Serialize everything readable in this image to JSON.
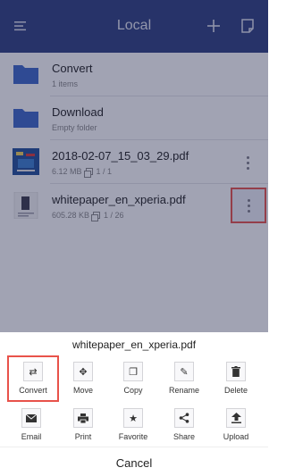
{
  "header": {
    "title": "Local",
    "left_icon": "menu-icon",
    "add_icon": "plus-icon",
    "edit_icon": "note-icon"
  },
  "files": [
    {
      "name": "Convert",
      "meta": "1 items",
      "type": "folder"
    },
    {
      "name": "Download",
      "meta": "Empty folder",
      "type": "folder"
    },
    {
      "name": "2018-02-07_15_03_29.pdf",
      "size": "6.12 MB",
      "pages": "1 / 1",
      "type": "pdf"
    },
    {
      "name": "whitepaper_en_xperia.pdf",
      "size": "605.28 KB",
      "pages": "1 / 26",
      "type": "pdf"
    }
  ],
  "sheet": {
    "title": "whitepaper_en_xperia.pdf",
    "actions": [
      {
        "label": "Convert",
        "icon": "convert-icon"
      },
      {
        "label": "Move",
        "icon": "move-icon"
      },
      {
        "label": "Copy",
        "icon": "copy-icon"
      },
      {
        "label": "Rename",
        "icon": "rename-icon"
      },
      {
        "label": "Delete",
        "icon": "trash-icon"
      },
      {
        "label": "Email",
        "icon": "mail-icon"
      },
      {
        "label": "Print",
        "icon": "printer-icon"
      },
      {
        "label": "Favorite",
        "icon": "star-icon"
      },
      {
        "label": "Share",
        "icon": "share-icon"
      },
      {
        "label": "Upload",
        "icon": "upload-icon"
      }
    ],
    "cancel": "Cancel"
  },
  "colors": {
    "header_bg": "#2d3e80",
    "folder": "#3b66c9",
    "highlight": "#e8524a"
  }
}
